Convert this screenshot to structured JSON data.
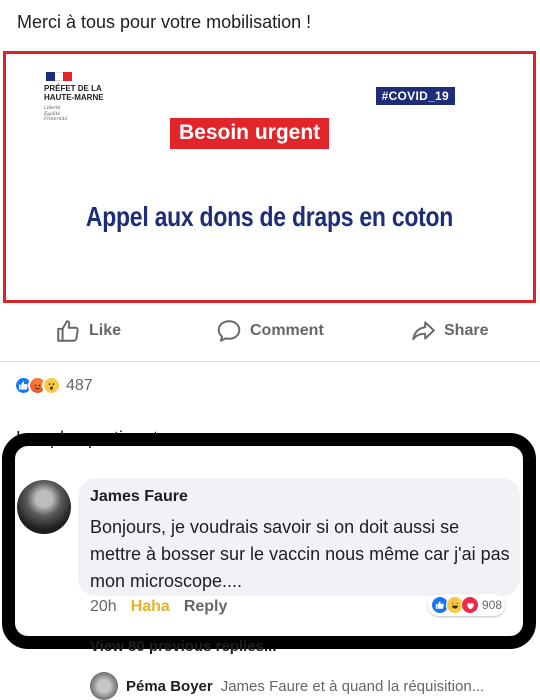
{
  "post": {
    "text": "Merci à tous pour votre mobilisation !"
  },
  "image_card": {
    "prefet_line": "PRÉFET DE LA HAUTE-MARNE",
    "devise": [
      "Liberté",
      "Égalité",
      "Fraternité"
    ],
    "hashtag": "#COVID_19",
    "banner": "Besoin urgent",
    "headline": "Appel aux dons de draps en coton"
  },
  "actions": {
    "like": "Like",
    "comment": "Comment",
    "share": "Share"
  },
  "reactions": {
    "types": [
      "like-icon",
      "angry-icon",
      "wow-icon"
    ],
    "count": "487"
  },
  "comments_section": {
    "sort_label": "Les plus pertinents"
  },
  "comment": {
    "author": "James Faure",
    "text": "Bonjours, je voudrais savoir si on doit aussi se mettre à bosser sur le vaccin nous même car j'ai pas mon microscope....",
    "time": "20h",
    "reaction_label": "Haha",
    "reply_label": "Reply",
    "reactions": {
      "types": [
        "like-icon",
        "haha-icon",
        "love-icon"
      ],
      "count": "908"
    }
  },
  "replies": {
    "view_previous": "View 80 previous replies...",
    "latest": {
      "author": "Péma Boyer",
      "text": "James Faure et à quand la réquisition..."
    }
  },
  "colors": {
    "fb_blue": "#1877f2",
    "card_border": "#d8232a",
    "banner_red": "#e2252b",
    "navy": "#1e2d78",
    "muted": "#65676b"
  }
}
